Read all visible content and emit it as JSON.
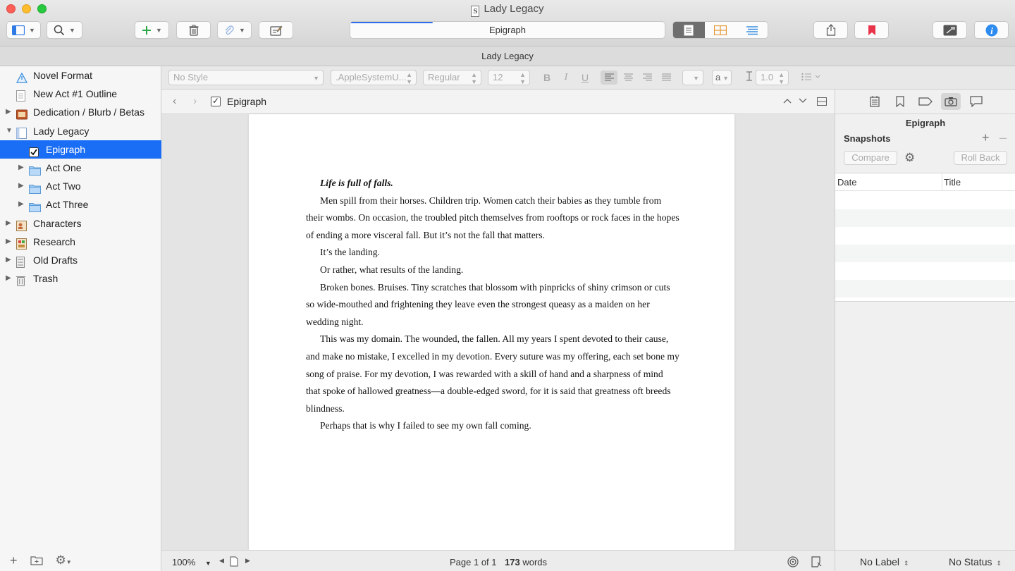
{
  "window": {
    "title": "Lady Legacy"
  },
  "header_strip": {
    "title": "Lady Legacy"
  },
  "toolbar": {
    "search_field_text": "Epigraph",
    "bookmark_color": "#e8334a",
    "info_color": "#2e8cf0"
  },
  "binder": {
    "items": [
      {
        "label": "Novel Format",
        "icon": "warning-triangle-icon",
        "indent": 0,
        "disclosure": "none"
      },
      {
        "label": "New Act #1 Outline",
        "icon": "text-document-icon",
        "indent": 0,
        "disclosure": "none"
      },
      {
        "label": "Dedication / Blurb / Betas",
        "icon": "front-matter-icon",
        "indent": 0,
        "disclosure": "collapsed"
      },
      {
        "label": "Lady Legacy",
        "icon": "manuscript-icon",
        "indent": 0,
        "disclosure": "expanded"
      },
      {
        "label": "Epigraph",
        "icon": "checkbox-icon",
        "indent": 1,
        "disclosure": "none",
        "selected": true
      },
      {
        "label": "Act One",
        "icon": "folder-icon",
        "indent": 1,
        "disclosure": "collapsed"
      },
      {
        "label": "Act Two",
        "icon": "folder-icon",
        "indent": 1,
        "disclosure": "collapsed"
      },
      {
        "label": "Act Three",
        "icon": "folder-icon",
        "indent": 1,
        "disclosure": "collapsed"
      },
      {
        "label": "Characters",
        "icon": "character-sheet-icon",
        "indent": 0,
        "disclosure": "collapsed"
      },
      {
        "label": "Research",
        "icon": "research-folder-icon",
        "indent": 0,
        "disclosure": "collapsed"
      },
      {
        "label": "Old Drafts",
        "icon": "drafts-icon",
        "indent": 0,
        "disclosure": "collapsed"
      },
      {
        "label": "Trash",
        "icon": "trash-icon",
        "indent": 0,
        "disclosure": "collapsed"
      }
    ]
  },
  "format_bar": {
    "style": "No Style",
    "font": ".AppleSystemU...",
    "weight": "Regular",
    "size": "12",
    "highlight_label": "a",
    "line_spacing": "1.0"
  },
  "editor": {
    "doc_title": "Epigraph",
    "paragraphs": [
      "Life is full of falls.",
      "Men spill from their horses. Children trip. Women catch their babies as they tumble from their wombs. On occasion, the troubled pitch themselves from rooftops or rock faces in the hopes of ending a more visceral fall. But it’s not the fall that matters.",
      "It’s the landing.",
      "Or rather, what results of the landing.",
      "Broken bones. Bruises. Tiny scratches that blossom with pinpricks of shiny crimson or cuts so wide-mouthed and frightening they leave even the strongest queasy as a maiden on her wedding night.",
      "This was my domain. The wounded, the fallen. All my years I spent devoted to their cause, and make no mistake, I excelled in my devotion. Every suture was my offering, each set bone my song of praise. For my devotion, I was rewarded with a skill of hand and a sharpness of mind that spoke of hallowed greatness—a double-edged sword, for it is said that greatness oft breeds blindness.",
      "Perhaps that is why I failed to see my own fall coming."
    ]
  },
  "footer": {
    "zoom": "100%",
    "page_count": "Page 1 of 1",
    "word_count": "173",
    "word_unit": "words"
  },
  "inspector": {
    "title": "Epigraph",
    "section": "Snapshots",
    "compare_label": "Compare",
    "rollback_label": "Roll Back",
    "columns": [
      "Date",
      "Title"
    ],
    "label_value": "No Label",
    "status_value": "No Status"
  }
}
